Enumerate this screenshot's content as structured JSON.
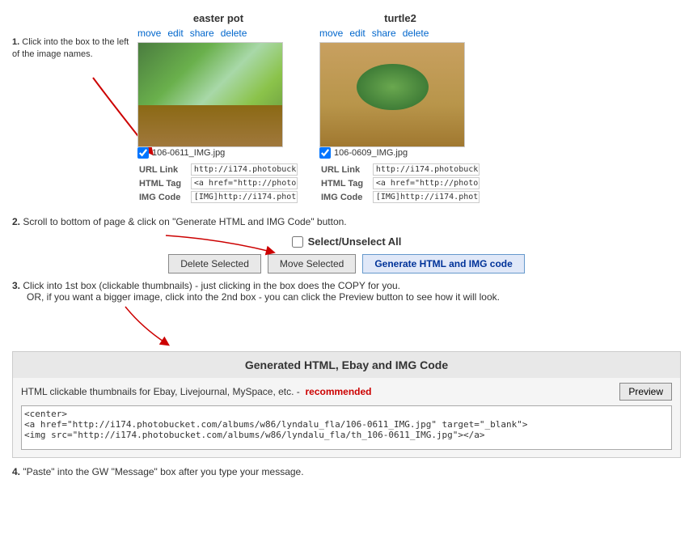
{
  "step1": {
    "number": "1.",
    "text": "Click into the box to the left of the image names."
  },
  "step2": {
    "number": "2.",
    "text": "Scroll to bottom of page & click on \"Generate HTML and IMG Code\" button."
  },
  "step3": {
    "number": "3.",
    "text1": "Click into 1st box (clickable thumbnails) - just clicking in the box does the COPY for you.",
    "text2": "OR, if you want a bigger image, click into the 2nd box - you can click the Preview button to see how it will look."
  },
  "step4": {
    "number": "4.",
    "text": "\"Paste\" into the GW \"Message\" box after you type your message."
  },
  "image1": {
    "title": "easter pot",
    "actions": [
      "move",
      "edit",
      "share",
      "delete"
    ],
    "filename": "106-0611_IMG.jpg",
    "url_label": "URL Link",
    "url_value": "http://i174.photobuck",
    "html_label": "HTML Tag",
    "html_value": "<a href=\"http://photol",
    "img_label": "IMG Code",
    "img_value": "[IMG]http://i174.phot"
  },
  "image2": {
    "title": "turtle2",
    "actions": [
      "move",
      "edit",
      "share",
      "delete"
    ],
    "filename": "106-0609_IMG.jpg",
    "url_label": "URL Link",
    "url_value": "http://i174.photobuck",
    "html_label": "HTML Tag",
    "html_value": "<a href=\"http://photol",
    "img_label": "IMG Code",
    "img_value": "[IMG]http://i174.phot"
  },
  "select_all": {
    "label": "Select/Unselect All"
  },
  "buttons": {
    "delete": "Delete Selected",
    "move": "Move Selected",
    "generate": "Generate HTML and IMG code"
  },
  "generated_section": {
    "title": "Generated HTML, Ebay and IMG Code",
    "subtitle_before": "HTML clickable thumbnails for Ebay, Livejournal, MySpace, etc. -",
    "recommended": "recommended",
    "preview_label": "Preview",
    "code": "<center>\n<a href=\"http://i174.photobucket.com/albums/w86/lyndalu_fla/106-0611_IMG.jpg\" target=\"_blank\">\n<img src=\"http://i174.photobucket.com/albums/w86/lyndalu_fla/th_106-0611_IMG.jpg\"></a>"
  }
}
